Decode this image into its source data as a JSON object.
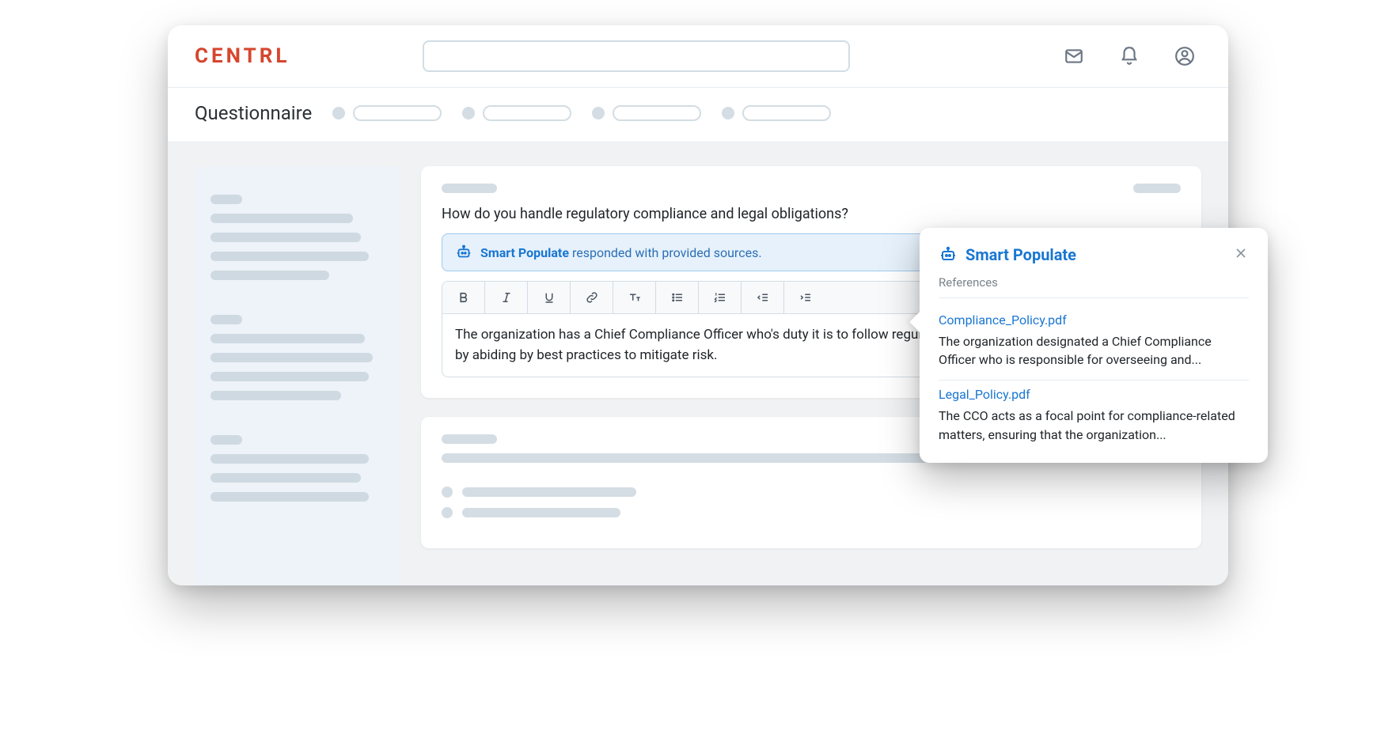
{
  "brand": "CENTRL",
  "page_title": "Questionnaire",
  "card": {
    "question": "How do you handle regulatory compliance and legal obligations?",
    "sp_label": "Smart Populate",
    "sp_rest": " responded with provided sources.",
    "answer": "The organization has a Chief Compliance Officer who's duty it is to follow regulatory compliance and legal obligations by abiding by best practices to mitigate risk."
  },
  "popover": {
    "title": "Smart Populate",
    "references_label": "References",
    "refs": [
      {
        "file": "Compliance_Policy.pdf",
        "excerpt": "The organization designated a Chief Compliance Officer who is responsible for overseeing and..."
      },
      {
        "file": "Legal_Policy.pdf",
        "excerpt": "The CCO acts as a focal point for compliance-related matters, ensuring that the organization..."
      }
    ]
  }
}
